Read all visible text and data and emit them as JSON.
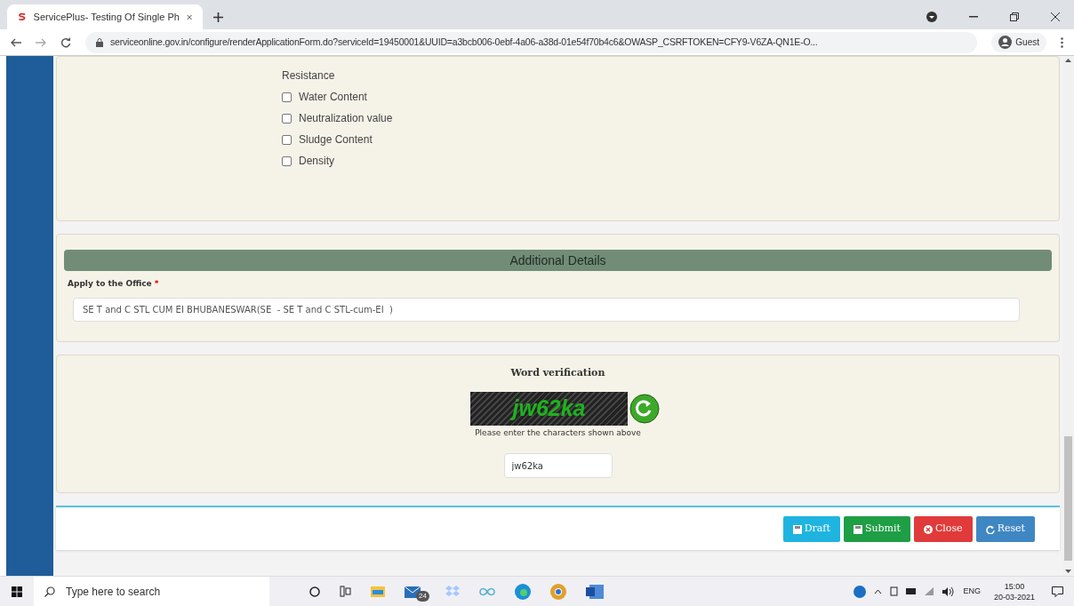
{
  "browser": {
    "tab_title": "ServicePlus- Testing Of Single Ph",
    "url": "serviceonline.gov.in/configure/renderApplicationForm.do?serviceId=19450001&UUID=a3bcb006-0ebf-4a06-a38d-01e54f70b4c6&OWASP_CSRFTOKEN=CFY9-V6ZA-QN1E-O...",
    "profile": "Guest"
  },
  "tests": {
    "wrapped_tail": "Resistance",
    "items": [
      {
        "label": "Water Content",
        "checked": false
      },
      {
        "label": "Neutralization value",
        "checked": false
      },
      {
        "label": "Sludge Content",
        "checked": false
      },
      {
        "label": "Density",
        "checked": false
      }
    ]
  },
  "additional": {
    "heading": "Additional Details",
    "field_label": "Apply to the Office",
    "required_mark": "*",
    "value": "SE T and C STL CUM EI BHUBANESWAR(SE  - SE T and C STL-cum-EI  )"
  },
  "verification": {
    "title": "Word verification",
    "captcha": "jw62ka",
    "hint": "Please enter the characters shown above",
    "value": "jw62ka"
  },
  "buttons": [
    {
      "label": "Draft",
      "kind": "draft"
    },
    {
      "label": "Submit",
      "kind": "submit"
    },
    {
      "label": "Close",
      "kind": "close"
    },
    {
      "label": "Reset",
      "kind": "reset"
    }
  ],
  "taskbar": {
    "search_placeholder": "Type here to search",
    "mail_badge": "24",
    "language": "ENG",
    "time": "15:00",
    "date": "20-03-2021"
  }
}
